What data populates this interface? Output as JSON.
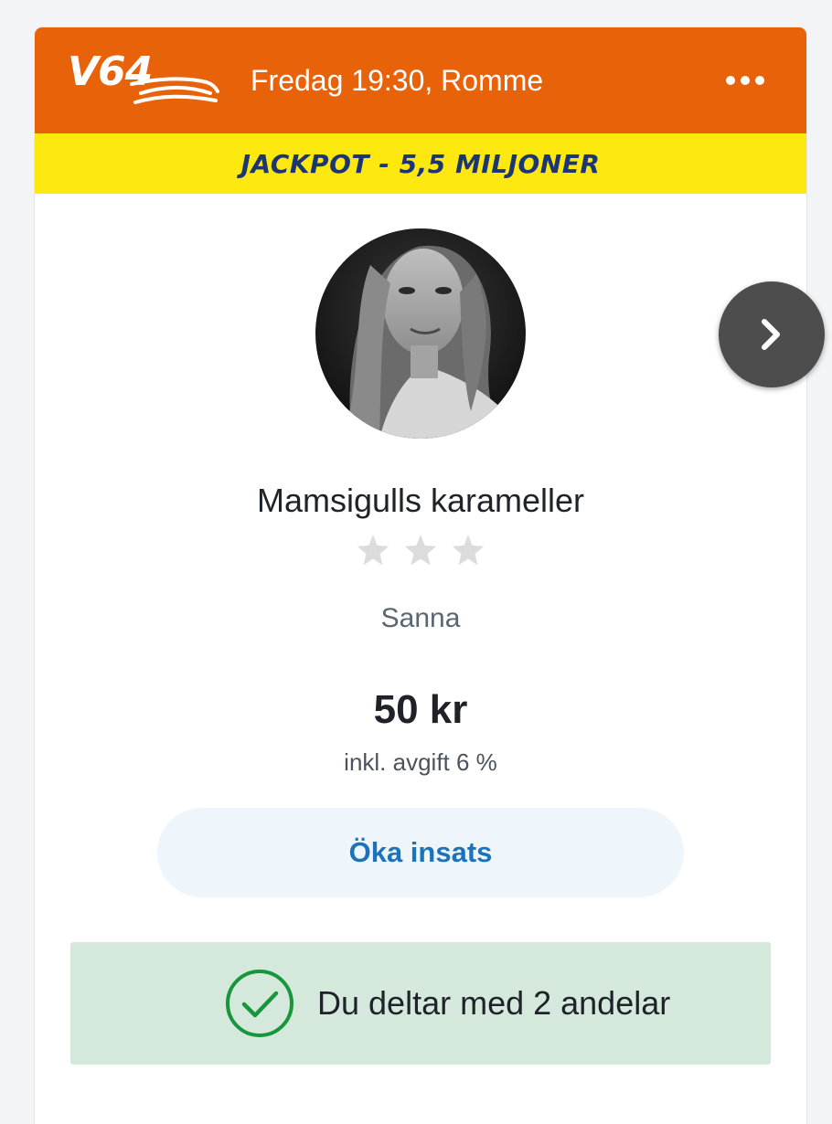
{
  "header": {
    "logo_text": "V64",
    "title": "Fredag 19:30, Romme",
    "more_icon": "more-horizontal-icon",
    "background_color": "#e8620a"
  },
  "banner": {
    "text": "JACKPOT - 5,5 MILJONER",
    "background_color": "#fde910",
    "text_color": "#1d3570"
  },
  "team": {
    "name": "Mamsigulls karameller",
    "rating": 0,
    "rating_max": 3,
    "host": "Sanna",
    "price": "50 kr",
    "fee": "inkl. avgift 6 %"
  },
  "actions": {
    "increase_label": "Öka insats",
    "next_icon": "chevron-right-icon"
  },
  "status": {
    "text": "Du deltar med 2 andelar",
    "icon": "check-circle-icon",
    "background_color": "#d4e9dc",
    "icon_color": "#17963b"
  }
}
